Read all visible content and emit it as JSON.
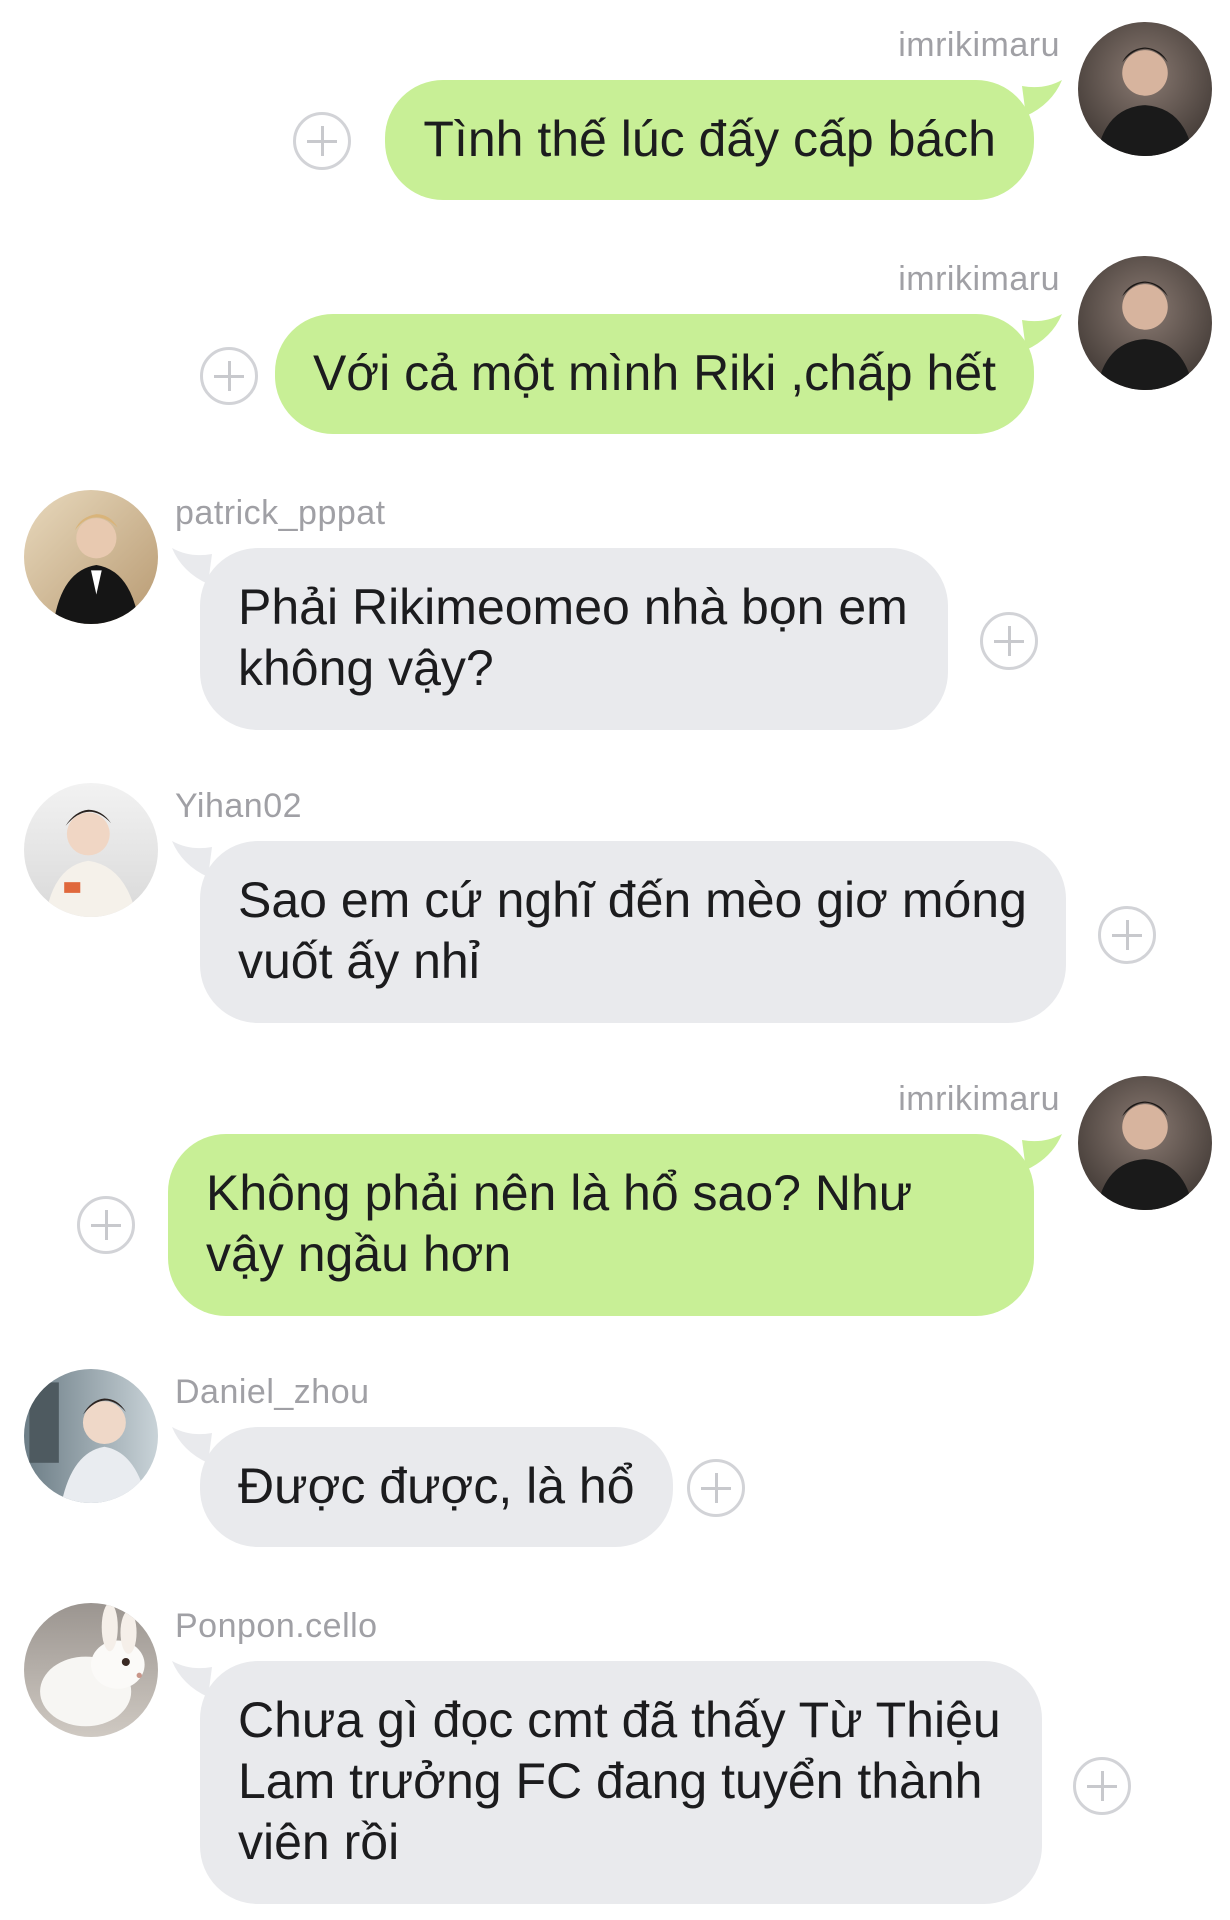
{
  "colors": {
    "outgoing_bubble": "#c8ef96",
    "incoming_bubble": "#e9eaed",
    "username_text": "#a0a0a5",
    "plus_icon": "#d2d3d7"
  },
  "messages": [
    {
      "direction": "outgoing",
      "username": "imrikimaru",
      "avatar": "avatar-icon",
      "text": "Tình thế lúc đấy cấp bách",
      "action_icon": "add-reaction-icon"
    },
    {
      "direction": "outgoing",
      "username": "imrikimaru",
      "avatar": "avatar-icon",
      "text": "Với cả một mình Riki ,chấp hết",
      "action_icon": "add-reaction-icon"
    },
    {
      "direction": "incoming",
      "username": "patrick_pppat",
      "avatar": "avatar-icon",
      "text": "Phải Rikimeomeo nhà bọn em không vậy?",
      "action_icon": "add-reaction-icon"
    },
    {
      "direction": "incoming",
      "username": "Yihan02",
      "avatar": "avatar-icon",
      "text": "Sao em cứ nghĩ đến mèo giơ móng vuốt ấy nhỉ",
      "action_icon": "add-reaction-icon"
    },
    {
      "direction": "outgoing",
      "username": "imrikimaru",
      "avatar": "avatar-icon",
      "text": "Không phải nên là hổ sao? Như vậy ngầu hơn",
      "action_icon": "add-reaction-icon"
    },
    {
      "direction": "incoming",
      "username": "Daniel_zhou",
      "avatar": "avatar-icon",
      "text": "Được được, là hổ",
      "action_icon": "add-reaction-icon"
    },
    {
      "direction": "incoming",
      "username": "Ponpon.cello",
      "avatar": "rabbit-avatar-icon",
      "text": "Chưa gì đọc cmt đã thấy Từ Thiệu Lam trưởng FC đang tuyển thành viên rồi",
      "action_icon": "add-reaction-icon"
    }
  ]
}
